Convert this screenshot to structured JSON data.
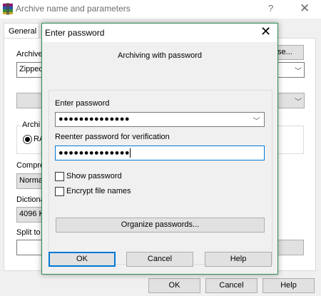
{
  "background_window": {
    "title": "Archive name and parameters",
    "help_glyph": "?",
    "close_glyph": "✕",
    "tab_general": "General",
    "archive_name_label_partial": "Archive",
    "archive_field_partial": "Zipped",
    "browse_button_partial": "se...",
    "archive_format_label_partial": "Archi",
    "radio_rar_partial": "RA",
    "compression_label_partial": "Compre",
    "compression_value_partial": "Norma",
    "dictionary_label_partial": "Dictiona",
    "dictionary_value_partial": "4096 K",
    "split_label_partial": "Split to",
    "ok_label": "OK",
    "cancel_label": "Cancel",
    "help_label": "Help"
  },
  "dialog": {
    "title": "Enter password",
    "close_glyph": "✕",
    "subtitle": "Archiving with password",
    "enter_password_label": "Enter password",
    "enter_password_value": "●●●●●●●●●●●●●●",
    "reenter_label": "Reenter password for verification",
    "reenter_value": "●●●●●●●●●●●●●●",
    "show_password_label": "Show password",
    "show_password_checked": false,
    "encrypt_names_label": "Encrypt file names",
    "encrypt_names_checked": false,
    "organize_button": "Organize passwords...",
    "ok_label": "OK",
    "cancel_label": "Cancel",
    "help_label": "Help"
  },
  "icons": {
    "app": "winrar-icon",
    "dropdown": "chevron-down-icon"
  },
  "colors": {
    "dialog_border": "#2e8b57",
    "focus_blue": "#0078d7",
    "button_face": "#e1e1e1"
  }
}
